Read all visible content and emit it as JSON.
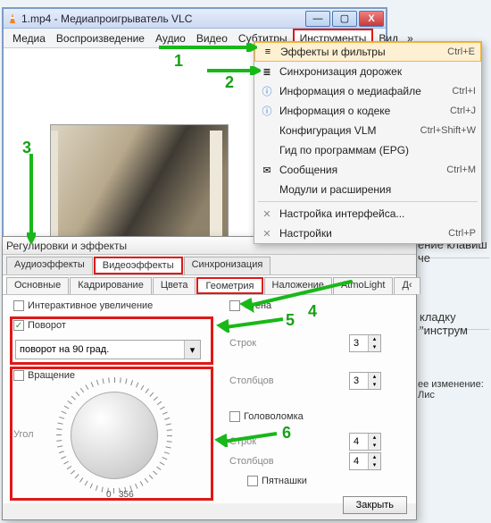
{
  "window": {
    "title": "1.mp4 - Медиапроигрыватель VLC",
    "min": "—",
    "max": "▢",
    "close": "X"
  },
  "menu": {
    "items": [
      "Медиа",
      "Воспроизведение",
      "Аудио",
      "Видео",
      "Субтитры",
      "Инструменты",
      "Вид"
    ],
    "highlight_index": 5
  },
  "dropdown": {
    "items": [
      {
        "icon": "≡",
        "label": "Эффекты и фильтры",
        "shortcut": "Ctrl+E",
        "hl": true
      },
      {
        "icon": "≣",
        "label": "Синхронизация дорожек",
        "shortcut": ""
      },
      {
        "icon": "ⓘ",
        "label": "Информация о медиафайле",
        "shortcut": "Ctrl+I"
      },
      {
        "icon": "ⓘ",
        "label": "Информация о кодеке",
        "shortcut": "Ctrl+J"
      },
      {
        "icon": "",
        "label": "Конфигурация VLM",
        "shortcut": "Ctrl+Shift+W"
      },
      {
        "icon": "",
        "label": "Гид по программам (EPG)",
        "shortcut": ""
      },
      {
        "icon": "✉",
        "label": "Сообщения",
        "shortcut": "Ctrl+M"
      },
      {
        "icon": "",
        "label": "Модули и расширения",
        "shortcut": ""
      },
      {
        "sep": true
      },
      {
        "icon": "✕",
        "label": "Настройка интерфейса...",
        "shortcut": ""
      },
      {
        "icon": "✕",
        "label": "Настройки",
        "shortcut": "Ctrl+P"
      }
    ]
  },
  "effects": {
    "title": "Регулировки и эффекты",
    "tabs1": [
      "Аудиоэффекты",
      "Видеоэффекты",
      "Синхронизация"
    ],
    "tabs1_hl": 1,
    "tabs2": [
      "Основные",
      "Кадрирование",
      "Цвета",
      "Геометрия",
      "Наложение",
      "AtmoLight",
      "Д‹"
    ],
    "tabs2_hl": 3,
    "interactive_zoom": "Интерактивное увеличение",
    "rotate": "Поворот",
    "rotate_value": "поворот на 90 град.",
    "rotation": "Вращение",
    "angle_label": "Угол",
    "angle_tick0": "0",
    "angle_tick356": "356",
    "wall": "Стена",
    "rows": "Строк",
    "cols": "Столбцов",
    "puzzle": "Головоломка",
    "rows2": "Строк",
    "cols2": "Столбцов",
    "tiles": "Пятнашки",
    "v3": "3",
    "v4": "4",
    "close_btn": "Закрыть"
  },
  "annotations": {
    "n1": "1",
    "n2": "2",
    "n3": "3",
    "n4": "4",
    "n5": "5",
    "n6": "6"
  },
  "bg": {
    "t1": "ение клавиш че",
    "t2": "кладку \"инструм",
    "t3": "ее изменение: Лис"
  }
}
